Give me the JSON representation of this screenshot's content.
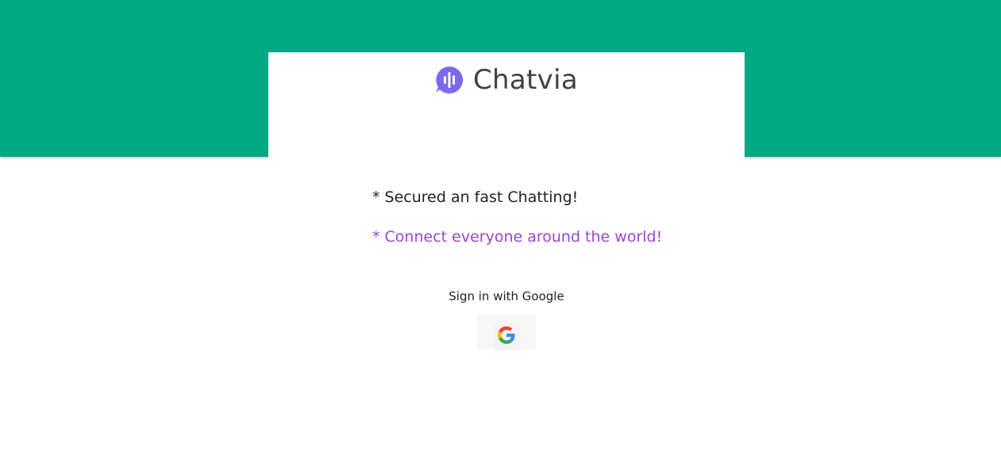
{
  "header": {
    "brand_name": "Chatvia",
    "brand_icon": "chat-bubble-waveform-icon",
    "band_color": "#00a884",
    "brand_color": "#7b68ee"
  },
  "main": {
    "tagline_primary": "* Secured an fast Chatting!",
    "tagline_secondary": "* Connect everyone around the world!",
    "tagline_secondary_color": "#9b44d6"
  },
  "auth": {
    "sign_in_label": "Sign in with Google",
    "google_icon": "google-g-icon"
  }
}
